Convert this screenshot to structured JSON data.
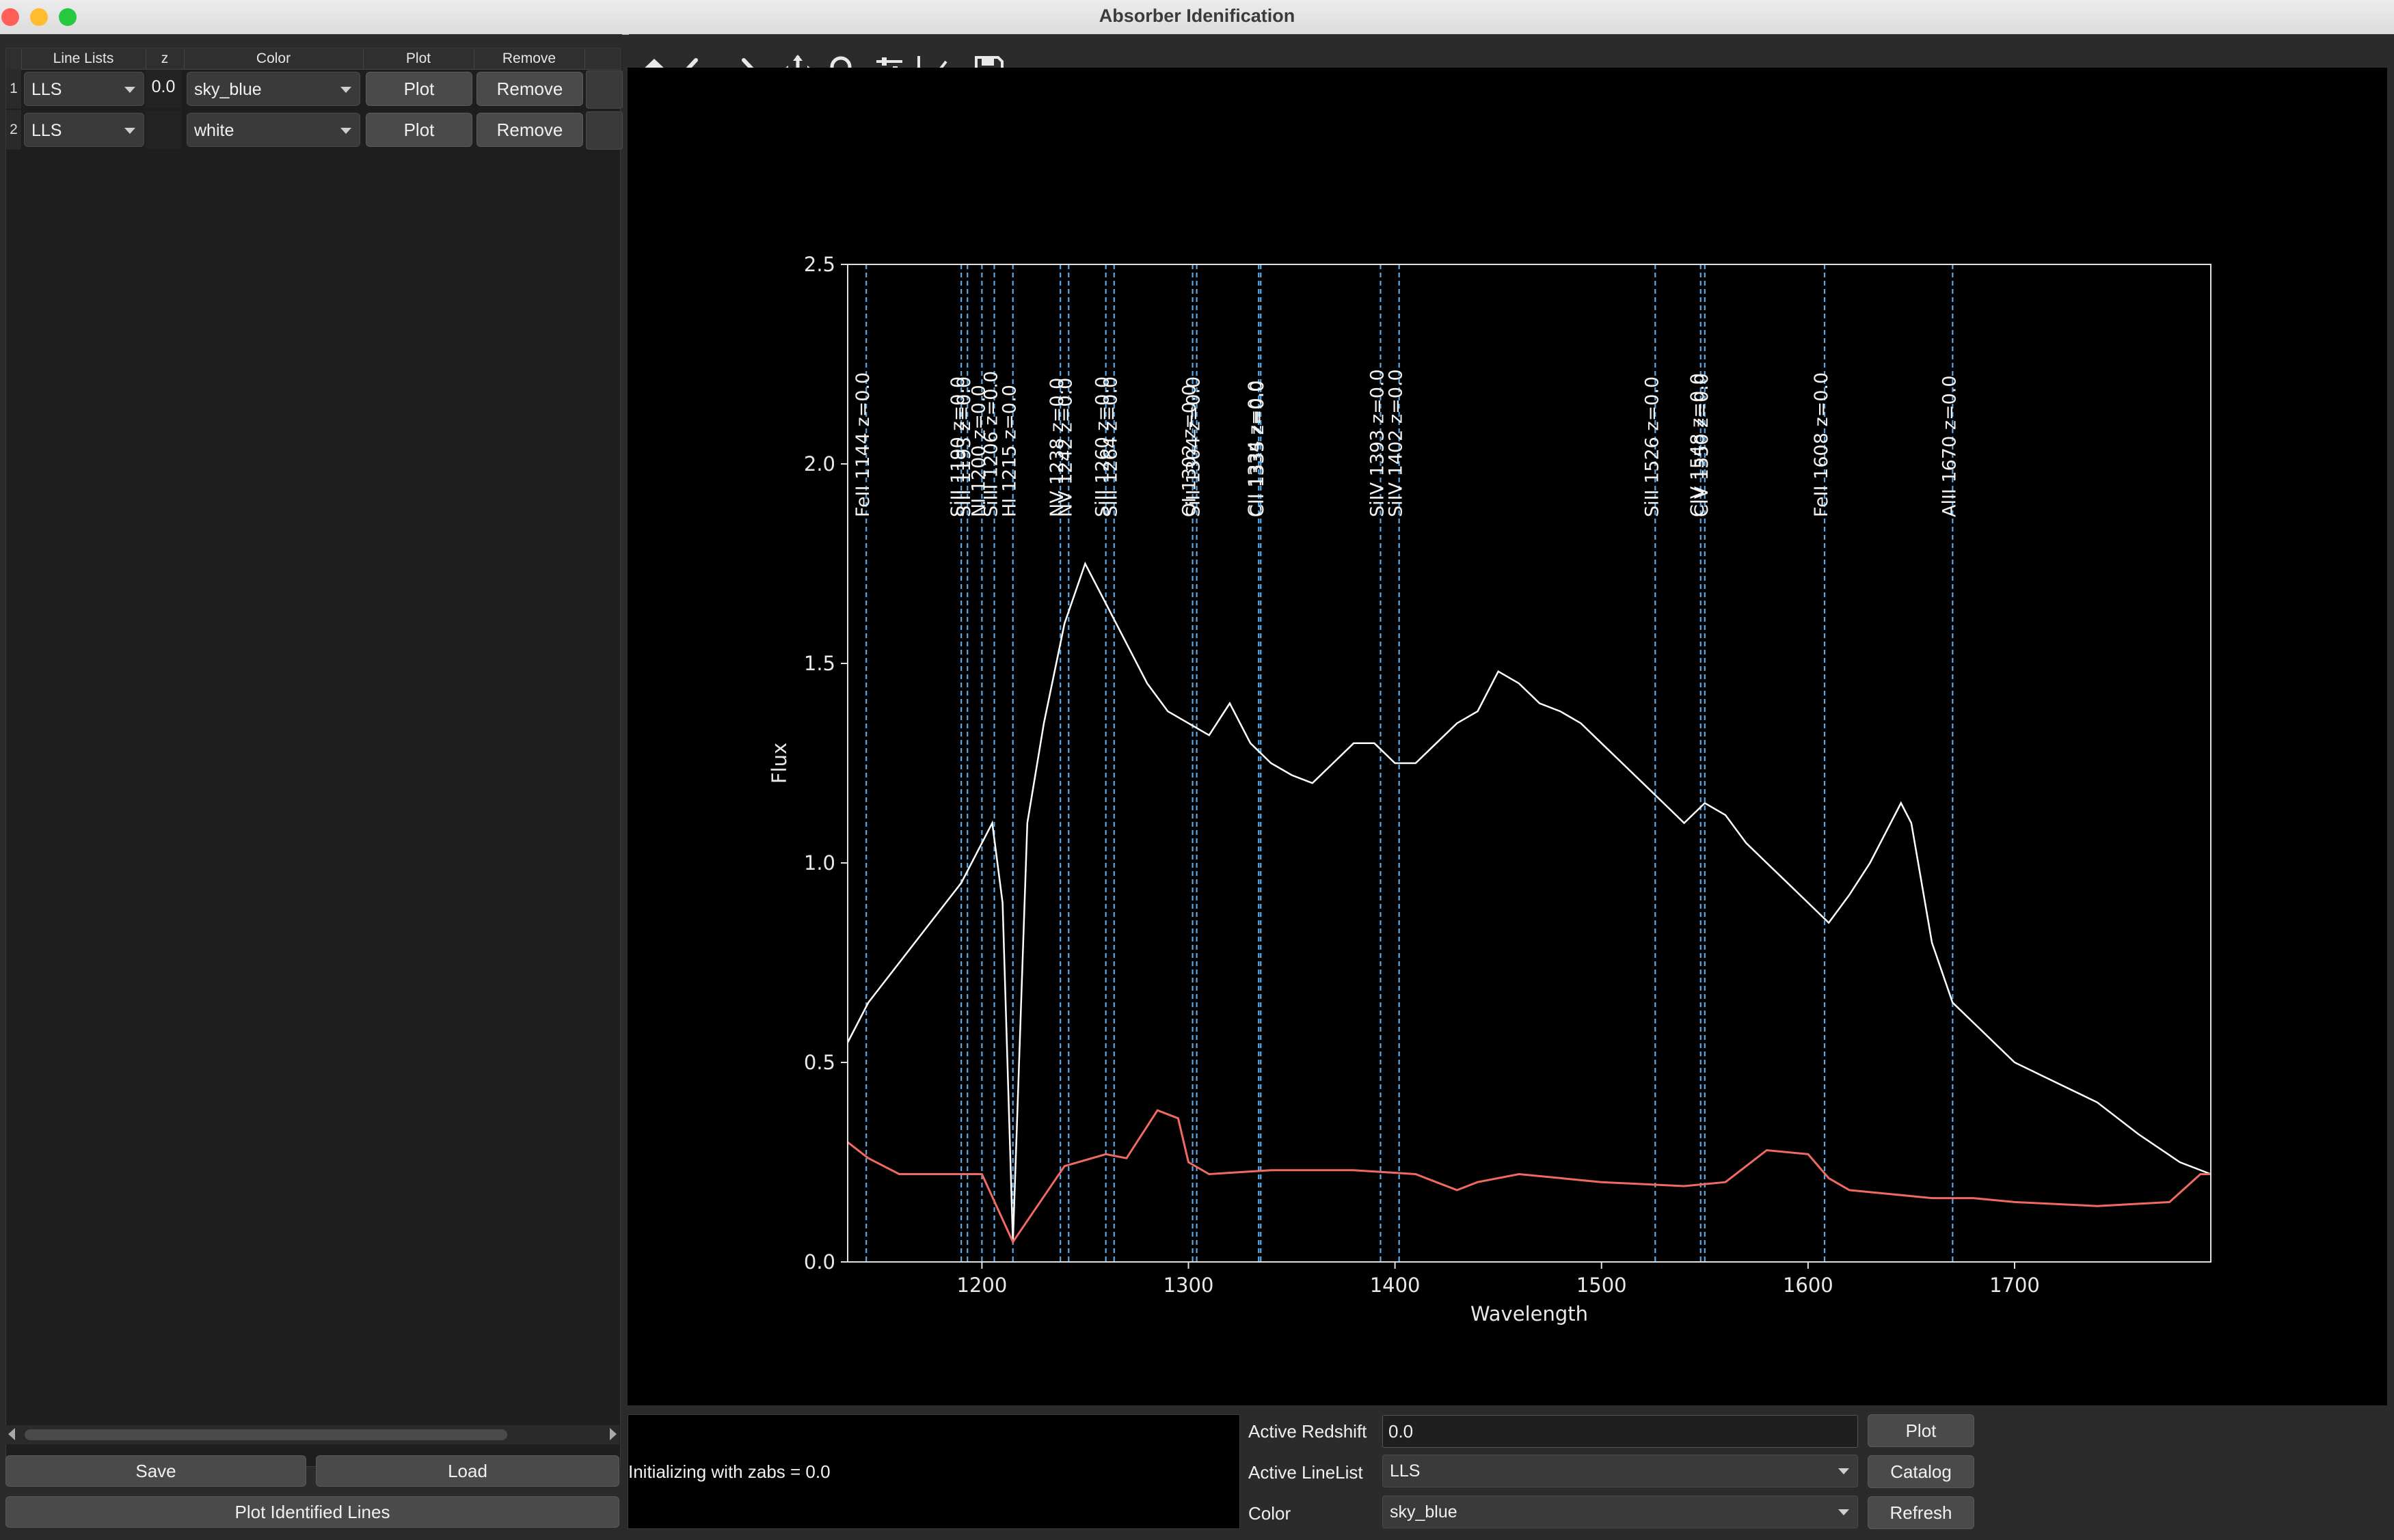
{
  "window": {
    "title": "Absorber Idenification"
  },
  "table": {
    "headers": {
      "line_lists": "Line Lists",
      "z": "z",
      "color": "Color",
      "plot": "Plot",
      "remove": "Remove"
    },
    "rows": [
      {
        "index": "1",
        "line_list": "LLS",
        "z": "0.0",
        "color": "sky_blue",
        "plot": "Plot",
        "remove": "Remove"
      },
      {
        "index": "2",
        "line_list": "LLS",
        "z": "",
        "color": "white",
        "plot": "Plot",
        "remove": "Remove"
      }
    ]
  },
  "left_buttons": {
    "save": "Save",
    "load": "Load",
    "plot_identified": "Plot Identified Lines"
  },
  "toolbar": {
    "icons": [
      "home-icon",
      "back-arrow-icon",
      "forward-arrow-icon",
      "pan-move-icon",
      "zoom-magnifier-icon",
      "configure-subplots-icon",
      "edit-axis-icon",
      "save-figure-icon"
    ]
  },
  "message": "Initializing with zabs = 0.0",
  "controls": {
    "active_redshift_label": "Active Redshift",
    "active_redshift_value": "0.0",
    "active_linelist_label": "Active LineList",
    "active_linelist_value": "LLS",
    "color_label": "Color",
    "color_value": "sky_blue",
    "plot_button": "Plot",
    "catalog_button": "Catalog",
    "refresh_button": "Refresh"
  },
  "chart_data": {
    "type": "line",
    "xlabel": "Wavelength",
    "ylabel": "Flux",
    "xlim": [
      1135,
      1795
    ],
    "ylim": [
      0,
      2.5
    ],
    "xticks": [
      1200,
      1300,
      1400,
      1500,
      1600,
      1700
    ],
    "yticks": [
      "0.0",
      "0.5",
      "1.0",
      "1.5",
      "2.0",
      "2.5"
    ],
    "background": "#000000",
    "flux_color": "#ffffff",
    "error_color": "#f06a61",
    "line_marker_color": "#5aa8e6",
    "series": [
      {
        "name": "flux",
        "x": [
          1135,
          1145,
          1160,
          1175,
          1190,
          1200,
          1205,
          1210,
          1215,
          1222,
          1230,
          1240,
          1250,
          1260,
          1270,
          1280,
          1290,
          1300,
          1310,
          1320,
          1330,
          1340,
          1350,
          1360,
          1370,
          1380,
          1390,
          1400,
          1410,
          1420,
          1430,
          1440,
          1450,
          1460,
          1470,
          1480,
          1490,
          1500,
          1510,
          1520,
          1530,
          1540,
          1550,
          1560,
          1570,
          1580,
          1590,
          1600,
          1610,
          1620,
          1630,
          1640,
          1645,
          1650,
          1660,
          1670,
          1680,
          1690,
          1700,
          1720,
          1740,
          1760,
          1780,
          1795
        ],
        "y": [
          0.55,
          0.65,
          0.75,
          0.85,
          0.95,
          1.05,
          1.1,
          0.9,
          0.05,
          1.1,
          1.35,
          1.6,
          1.75,
          1.65,
          1.55,
          1.45,
          1.38,
          1.35,
          1.32,
          1.4,
          1.3,
          1.25,
          1.22,
          1.2,
          1.25,
          1.3,
          1.3,
          1.25,
          1.25,
          1.3,
          1.35,
          1.38,
          1.48,
          1.45,
          1.4,
          1.38,
          1.35,
          1.3,
          1.25,
          1.2,
          1.15,
          1.1,
          1.15,
          1.12,
          1.05,
          1.0,
          0.95,
          0.9,
          0.85,
          0.92,
          1.0,
          1.1,
          1.15,
          1.1,
          0.8,
          0.65,
          0.6,
          0.55,
          0.5,
          0.45,
          0.4,
          0.32,
          0.25,
          0.22
        ]
      },
      {
        "name": "error",
        "x": [
          1135,
          1145,
          1160,
          1200,
          1215,
          1240,
          1260,
          1270,
          1285,
          1295,
          1300,
          1310,
          1340,
          1380,
          1410,
          1420,
          1430,
          1440,
          1460,
          1500,
          1540,
          1560,
          1580,
          1600,
          1610,
          1620,
          1640,
          1660,
          1680,
          1700,
          1740,
          1775,
          1790,
          1795
        ],
        "y": [
          0.3,
          0.26,
          0.22,
          0.22,
          0.05,
          0.24,
          0.27,
          0.26,
          0.38,
          0.36,
          0.25,
          0.22,
          0.23,
          0.23,
          0.22,
          0.2,
          0.18,
          0.2,
          0.22,
          0.2,
          0.19,
          0.2,
          0.28,
          0.27,
          0.21,
          0.18,
          0.17,
          0.16,
          0.16,
          0.15,
          0.14,
          0.15,
          0.22,
          0.22
        ]
      }
    ],
    "lines": [
      {
        "label": "FeII 1144  z=0.0",
        "x": 1144
      },
      {
        "label": "SiII 1190  z=0.0",
        "x": 1190
      },
      {
        "label": "SiII 1193  z=0.0",
        "x": 1193
      },
      {
        "label": "NI 1200  z=0.0",
        "x": 1200
      },
      {
        "label": "SiIII 1206  z=0.0",
        "x": 1206
      },
      {
        "label": "HI 1215  z=0.0",
        "x": 1215
      },
      {
        "label": "NV 1238  z=0.0",
        "x": 1238
      },
      {
        "label": "NV 1242  z=0.0",
        "x": 1242
      },
      {
        "label": "SiII 1260  z=0.0",
        "x": 1260
      },
      {
        "label": "SiII 1264  z=0.0",
        "x": 1264
      },
      {
        "label": "OI 1302  z=0.0",
        "x": 1302
      },
      {
        "label": "SiII 1304  z=0.0",
        "x": 1304
      },
      {
        "label": "CII 1334  z=0.0",
        "x": 1334
      },
      {
        "label": "CII 1335  z=0.0",
        "x": 1335
      },
      {
        "label": "SiIV 1393  z=0.0",
        "x": 1393
      },
      {
        "label": "SiIV 1402  z=0.0",
        "x": 1402
      },
      {
        "label": "SiII 1526  z=0.0",
        "x": 1526
      },
      {
        "label": "CIV 1548  z=0.0",
        "x": 1548
      },
      {
        "label": "CIV 1550  z=0.0",
        "x": 1550
      },
      {
        "label": "FeII 1608  z=0.0",
        "x": 1608
      },
      {
        "label": "AlII 1670  z=0.0",
        "x": 1670
      }
    ]
  }
}
